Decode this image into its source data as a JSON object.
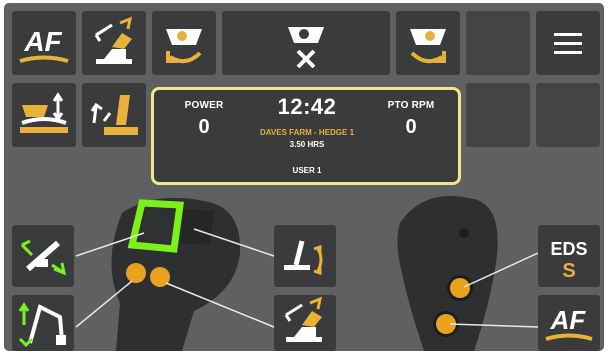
{
  "colors": {
    "accent_yellow": "#e8b23a",
    "highlight_green": "#7cf01a",
    "panel_border": "#f3e48a",
    "tile_bg": "#3a3b3d",
    "screen_bg": "#5e6062"
  },
  "top_row": [
    {
      "icon": "af-icon",
      "text": "AF"
    },
    {
      "icon": "head-angle-arrows-icon"
    },
    {
      "icon": "rotor-rotate-left-icon"
    },
    {
      "icon": "rotor-stop-icon"
    },
    {
      "icon": "rotor-rotate-right-icon"
    },
    {
      "icon": "blank"
    },
    {
      "icon": "menu-icon"
    }
  ],
  "second_row": [
    {
      "icon": "head-lift-icon"
    },
    {
      "icon": "arm-tilt-icon"
    }
  ],
  "status": {
    "power_label": "POWER",
    "power_value": "0",
    "time": "12:42",
    "pto_label": "PTO RPM",
    "pto_value": "0",
    "location": "DAVES FARM - HEDGE 1",
    "hours": "3.50 HRS",
    "user": "USER 1"
  },
  "left_lever_buttons": [
    {
      "icon": "arm-reach-icon"
    },
    {
      "icon": "boom-fold-icon"
    }
  ],
  "middle_lever_buttons": [
    {
      "icon": "head-tilt-icon"
    },
    {
      "icon": "head-angle-arrows-icon"
    }
  ],
  "right_lever_buttons": [
    {
      "icon": "eds-icon",
      "text": "EDS",
      "subtext": "S"
    },
    {
      "icon": "af-icon",
      "text": "AF"
    }
  ]
}
